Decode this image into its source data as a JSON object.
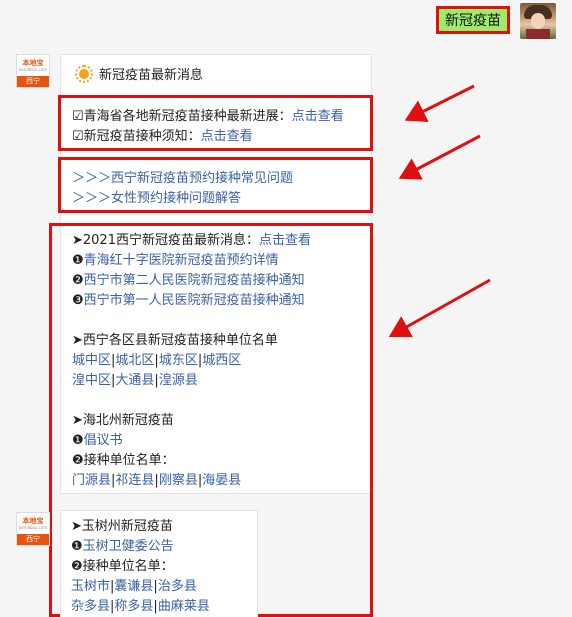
{
  "user_message": "新冠疫苗",
  "bot": {
    "brand": "本地宝",
    "brand_small": "bendibao.com",
    "city": "西宁"
  },
  "card_title": "新冠疫苗最新消息",
  "section1": {
    "line1_prefix": "☑青海省各地新冠疫苗接种最新进展：",
    "line1_link": "点击查看",
    "line2_prefix": "☑新冠疫苗接种须知：",
    "line2_link": "点击查看"
  },
  "section2": {
    "links": [
      "＞＞＞西宁新冠疫苗预约接种常见问题",
      "＞＞＞女性预约接种问题解答"
    ]
  },
  "section3": {
    "heading_prefix": "➤2021西宁新冠疫苗最新消息：",
    "heading_link": "点击查看",
    "items": [
      {
        "num": "❶",
        "text": "青海红十字医院新冠疫苗预约详情"
      },
      {
        "num": "❷",
        "text": "西宁市第二人民医院新冠疫苗接种通知"
      },
      {
        "num": "❸",
        "text": "西宁市第一人民医院新冠疫苗接种通知"
      }
    ],
    "units_heading": "➤西宁各区县新冠疫苗接种单位名单",
    "units_row1": [
      "城中区",
      "城北区",
      "城东区",
      "城西区"
    ],
    "units_row2": [
      "湟中区",
      "大通县",
      "湟源县"
    ],
    "haibei_heading": "➤海北州新冠疫苗",
    "haibei_item1_num": "❶",
    "haibei_item1": "倡议书",
    "haibei_item2": "❷接种单位名单：",
    "haibei_row": [
      "门源县",
      "祁连县",
      "刚察县",
      "海晏县"
    ]
  },
  "section4": {
    "heading": "➤玉树州新冠疫苗",
    "item1_num": "❶",
    "item1": "玉树卫健委公告",
    "item2": "❷接种单位名单：",
    "row1": [
      "玉树市",
      "囊谦县",
      "治多县"
    ],
    "row2": [
      "杂多县",
      "称多县",
      "曲麻莱县"
    ]
  },
  "separator": "|"
}
